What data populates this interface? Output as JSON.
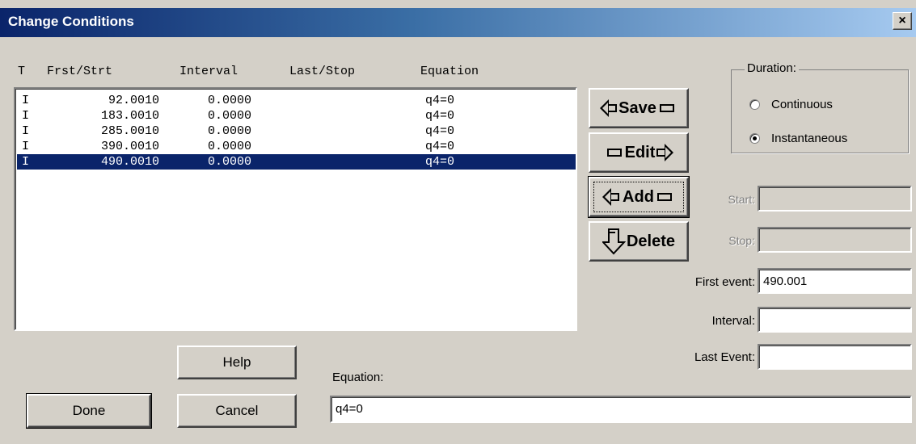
{
  "window": {
    "title": "Change Conditions",
    "close_label": "×"
  },
  "columns": {
    "t": "T",
    "first": "Frst/Strt",
    "interval": "Interval",
    "last": "Last/Stop",
    "equation": "Equation"
  },
  "rows": [
    {
      "t": "I",
      "first": "92.0010",
      "interval": "0.0000",
      "last": "",
      "equation": "q4=0",
      "selected": false
    },
    {
      "t": "I",
      "first": "183.0010",
      "interval": "0.0000",
      "last": "",
      "equation": "q4=0",
      "selected": false
    },
    {
      "t": "I",
      "first": "285.0010",
      "interval": "0.0000",
      "last": "",
      "equation": "q4=0",
      "selected": false
    },
    {
      "t": "I",
      "first": "390.0010",
      "interval": "0.0000",
      "last": "",
      "equation": "q4=0",
      "selected": false
    },
    {
      "t": "I",
      "first": "490.0010",
      "interval": "0.0000",
      "last": "",
      "equation": "q4=0",
      "selected": true
    }
  ],
  "buttons": {
    "save": "Save",
    "edit": "Edit",
    "add": "Add",
    "delete": "Delete",
    "help": "Help",
    "done": "Done",
    "cancel": "Cancel"
  },
  "duration": {
    "legend": "Duration:",
    "options": [
      {
        "label": "Continuous",
        "checked": false
      },
      {
        "label": "Instantaneous",
        "checked": true
      }
    ]
  },
  "fields": {
    "start": {
      "label": "Start:",
      "value": ""
    },
    "stop": {
      "label": "Stop:",
      "value": ""
    },
    "first_event": {
      "label": "First event:",
      "value": "490.001"
    },
    "interval": {
      "label": "Interval:",
      "value": ""
    },
    "last_event": {
      "label": "Last Event:",
      "value": ""
    },
    "equation": {
      "label": "Equation:",
      "value": "q4=0"
    }
  },
  "colors": {
    "selection": "#0a246a",
    "face": "#d4d0c8",
    "title_start": "#0a246a",
    "title_end": "#a6caf0"
  }
}
